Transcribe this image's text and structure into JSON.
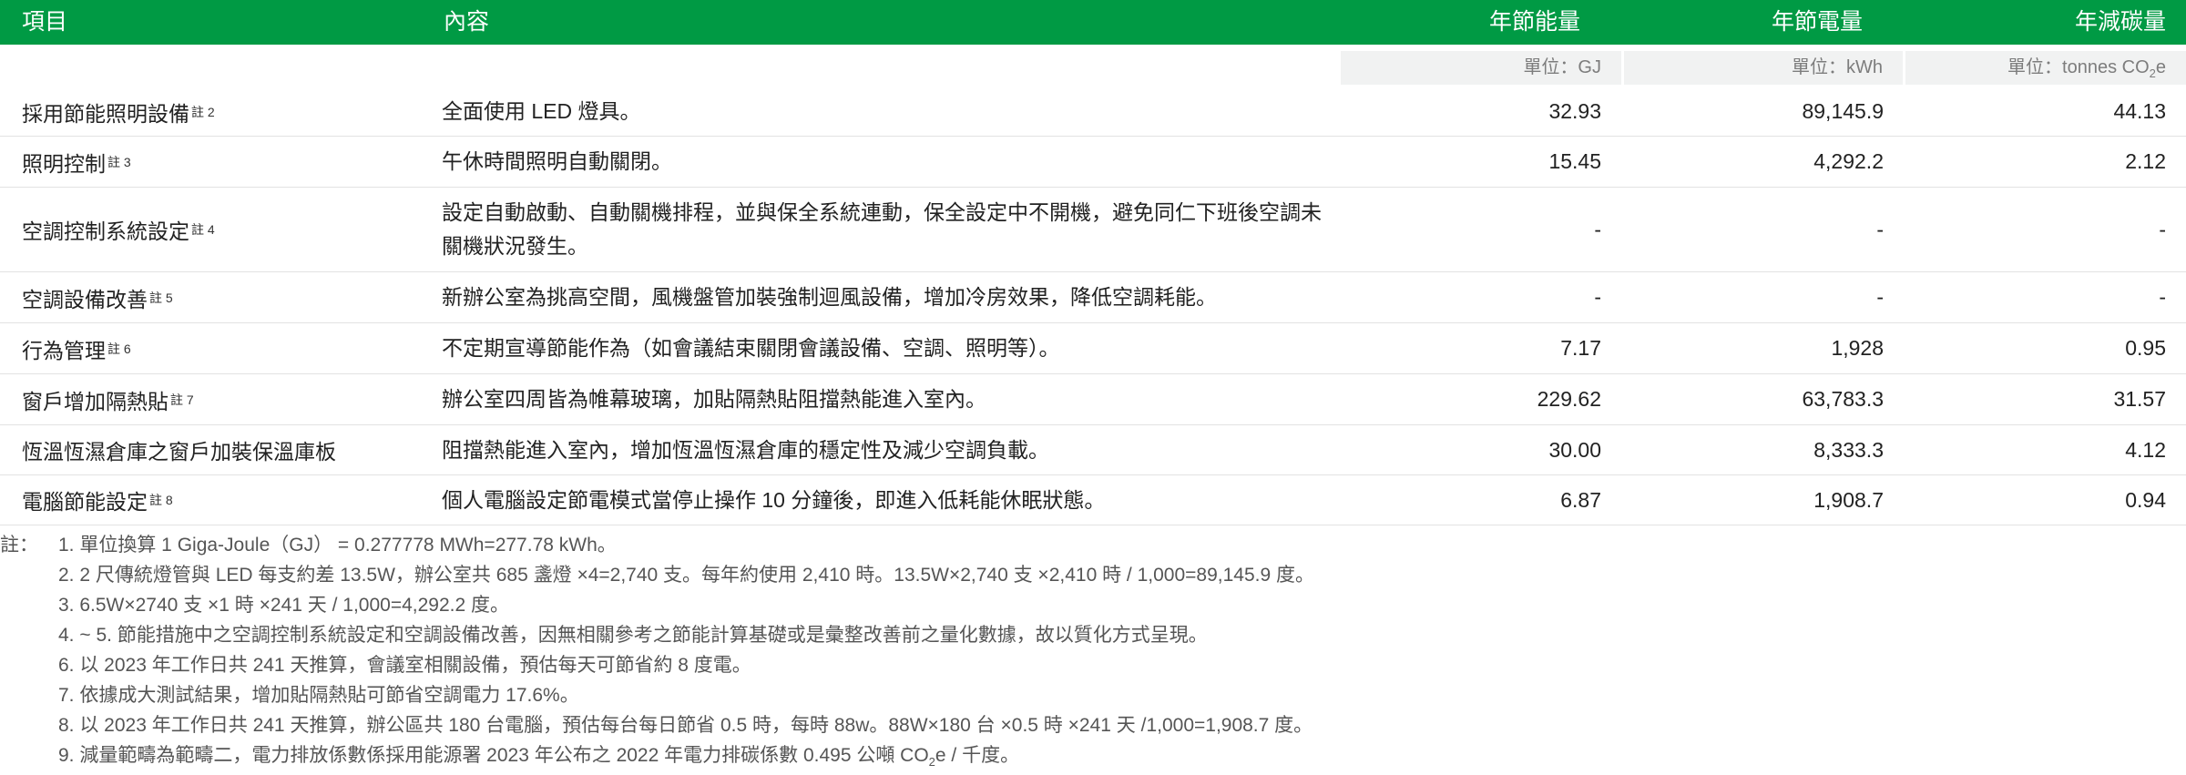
{
  "header": {
    "item": "項目",
    "content": "內容",
    "energy": "年節能量",
    "electricity": "年節電量",
    "carbon": "年減碳量"
  },
  "units": {
    "energy": "單位：GJ",
    "electricity": "單位：kWh",
    "carbon_prefix": "單位：tonnes CO",
    "carbon_sub": "2",
    "carbon_suffix": "e"
  },
  "rows": [
    {
      "item": "採用節能照明設備",
      "note": "註 2",
      "content": "全面使用 LED 燈具。",
      "energy": "32.93",
      "electricity": "89,145.9",
      "carbon": "44.13"
    },
    {
      "item": "照明控制",
      "note": "註 3",
      "content": "午休時間照明自動關閉。",
      "energy": "15.45",
      "electricity": "4,292.2",
      "carbon": "2.12"
    },
    {
      "item": "空調控制系統設定",
      "note": "註 4",
      "content": "設定自動啟動、自動關機排程，並與保全系統連動，保全設定中不開機，避免同仁下班後空調未關機狀況發生。",
      "energy": "-",
      "electricity": "-",
      "carbon": "-"
    },
    {
      "item": "空調設備改善",
      "note": "註 5",
      "content": "新辦公室為挑高空間，風機盤管加裝強制迴風設備，增加冷房效果，降低空調耗能。",
      "energy": "-",
      "electricity": "-",
      "carbon": "-"
    },
    {
      "item": "行為管理",
      "note": "註 6",
      "content": "不定期宣導節能作為（如會議結束關閉會議設備、空調、照明等）。",
      "energy": "7.17",
      "electricity": "1,928",
      "carbon": "0.95"
    },
    {
      "item": "窗戶增加隔熱貼",
      "note": "註 7",
      "content": "辦公室四周皆為帷幕玻璃，加貼隔熱貼阻擋熱能進入室內。",
      "energy": "229.62",
      "electricity": "63,783.3",
      "carbon": "31.57"
    },
    {
      "item": "恆溫恆濕倉庫之窗戶加裝保溫庫板",
      "note": "",
      "content": "阻擋熱能進入室內，增加恆溫恆濕倉庫的穩定性及減少空調負載。",
      "energy": "30.00",
      "electricity": "8,333.3",
      "carbon": "4.12"
    },
    {
      "item": "電腦節能設定",
      "note": "註 8",
      "content": "個人電腦設定節電模式當停止操作 10 分鐘後，即進入低耗能休眠狀態。",
      "energy": "6.87",
      "electricity": "1,908.7",
      "carbon": "0.94"
    }
  ],
  "notes": {
    "label": "註：",
    "lines": [
      "1. 單位換算 1 Giga-Joule（GJ） = 0.277778 MWh=277.78 kWh。",
      "2. 2 尺傳統燈管與 LED 每支約差 13.5W，辦公室共 685 盞燈 ×4=2,740 支。每年約使用 2,410 時。13.5W×2,740 支 ×2,410 時 / 1,000=89,145.9 度。",
      "3. 6.5W×2740 支 ×1 時 ×241 天 / 1,000=4,292.2 度。",
      "4. ~ 5. 節能措施中之空調控制系統設定和空調設備改善，因無相關參考之節能計算基礎或是彙整改善前之量化數據，故以質化方式呈現。",
      "6. 以 2023 年工作日共 241 天推算，會議室相關設備，預估每天可節省約 8 度電。",
      "7. 依據成大測試結果，增加貼隔熱貼可節省空調電力 17.6%。",
      "8. 以 2023 年工作日共 241 天推算，辦公區共 180 台電腦，預估每台每日節省 0.5 時，每時 88w。88W×180 台 ×0.5 時 ×241 天 /1,000=1,908.7 度。"
    ],
    "last_prefix": "9. 減量範疇為範疇二，電力排放係數係採用能源署 2023 年公布之 2022 年電力排碳係數 0.495 公噸 CO",
    "last_sub": "2",
    "last_suffix": "e  / 千度。"
  }
}
